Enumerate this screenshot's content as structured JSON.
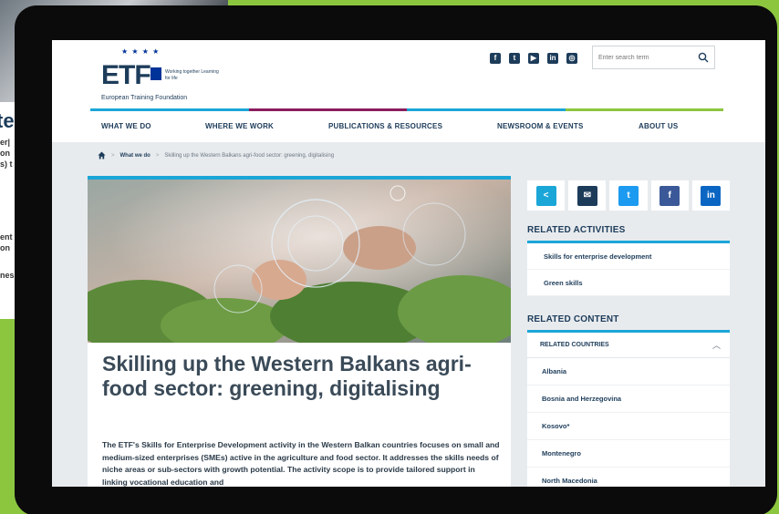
{
  "colors": {
    "frame_green": "#8cc63f",
    "navy": "#1d3c5a",
    "accent_blue": "#1ba6d8",
    "bar_colors": [
      "#1ba6d8",
      "#8b1e5e",
      "#1ba6d8",
      "#8cc63f"
    ]
  },
  "background": {
    "partial_title": "te",
    "partial_lines": [
      "er|",
      "on",
      "s) t",
      "",
      "ent",
      "on",
      "nes"
    ]
  },
  "header": {
    "logo": {
      "acronym": "ETF",
      "tagline": "Working together Learning for life",
      "name": "European Training Foundation"
    },
    "social_icons": [
      "facebook-icon",
      "youtube-icon",
      "twitter-icon",
      "linkedin-icon",
      "instagram-icon"
    ],
    "search": {
      "placeholder": "Enter search term"
    }
  },
  "nav": {
    "items": [
      {
        "label": "WHAT WE DO"
      },
      {
        "label": "WHERE WE WORK"
      },
      {
        "label": "PUBLICATIONS & RESOURCES"
      },
      {
        "label": "NEWSROOM & EVENTS"
      },
      {
        "label": "ABOUT US"
      }
    ]
  },
  "breadcrumb": {
    "items": [
      "What we do",
      "Skilling up the Western Balkans agri-food sector: greening, digitalising"
    ]
  },
  "article": {
    "title": "Skilling up the Western Balkans agri-food sector: greening, digitalising",
    "body": "The ETF's Skills for Enterprise Development activity in the Western Balkan countries focuses on small and medium-sized enterprises (SMEs) active in the agriculture and food sector. It addresses the skills needs of niche areas or sub-sectors with growth potential. The activity scope is to provide tailored support in linking vocational education and"
  },
  "sidebar": {
    "share_buttons": [
      {
        "icon": "share-icon",
        "color": "#1ba6d8",
        "glyph": "<"
      },
      {
        "icon": "email-icon",
        "color": "#1d3c5a",
        "glyph": "✉"
      },
      {
        "icon": "twitter-icon",
        "color": "#1d9bf0",
        "glyph": "t"
      },
      {
        "icon": "facebook-icon",
        "color": "#3b5998",
        "glyph": "f"
      },
      {
        "icon": "linkedin-icon",
        "color": "#0a66c2",
        "glyph": "in"
      }
    ],
    "related_activities": {
      "heading": "RELATED ACTIVITIES",
      "items": [
        "Skills for enterprise development",
        "Green skills"
      ]
    },
    "related_content": {
      "heading": "RELATED CONTENT",
      "sub_heading": "RELATED COUNTRIES",
      "countries": [
        "Albania",
        "Bosnia and Herzegovina",
        "Kosovo*",
        "Montenegro",
        "North Macedonia"
      ]
    }
  }
}
